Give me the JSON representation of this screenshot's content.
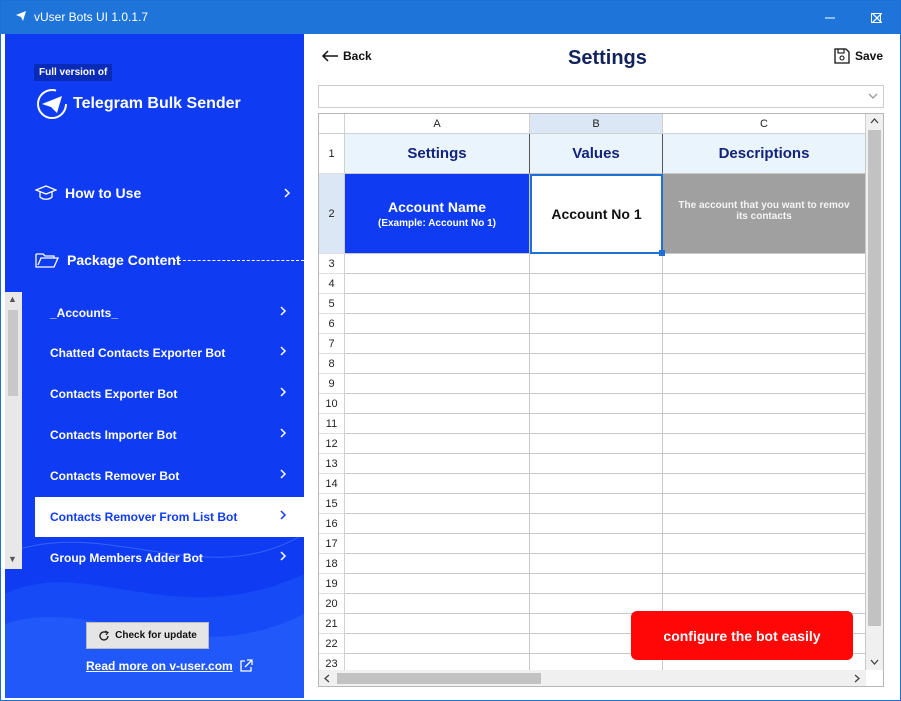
{
  "window": {
    "title": "vUser Bots UI 1.0.1.7"
  },
  "sidebar": {
    "badge": "Full version of",
    "app_name": "Telegram Bulk Sender",
    "how_to_use": "How to Use",
    "package_content": "Package Content",
    "items": [
      {
        "label": "_Accounts_"
      },
      {
        "label": "Chatted Contacts Exporter Bot"
      },
      {
        "label": "Contacts Exporter Bot"
      },
      {
        "label": "Contacts Importer Bot"
      },
      {
        "label": "Contacts Remover Bot"
      },
      {
        "label": "Contacts Remover From List Bot",
        "active": true
      },
      {
        "label": "Group Members Adder Bot"
      }
    ],
    "check_update": "Check for update",
    "read_more": "Read more on v-user.com"
  },
  "header": {
    "back": "Back",
    "title": "Settings",
    "save": "Save"
  },
  "grid": {
    "columns": [
      "A",
      "B",
      "C"
    ],
    "selected_column": "B",
    "header_row": {
      "settings": "Settings",
      "values": "Values",
      "descriptions": "Descriptions"
    },
    "row2": {
      "setting_title": "Account Name",
      "setting_example": "(Example: Account No 1)",
      "value": "Account No 1",
      "description_line1": "The account that you want to remov",
      "description_line2": "its contacts"
    },
    "row_numbers": [
      "1",
      "2",
      "3",
      "4",
      "5",
      "6",
      "7",
      "8",
      "9",
      "10",
      "11",
      "12",
      "13",
      "14",
      "15",
      "16",
      "17",
      "18",
      "19",
      "20",
      "21",
      "22",
      "23"
    ]
  },
  "toast": "configure the bot easily",
  "colors": {
    "sidebar": "#0f3cf3",
    "titlebar": "#1e74d8",
    "toast": "#ff0707",
    "header_text": "#13237a"
  }
}
